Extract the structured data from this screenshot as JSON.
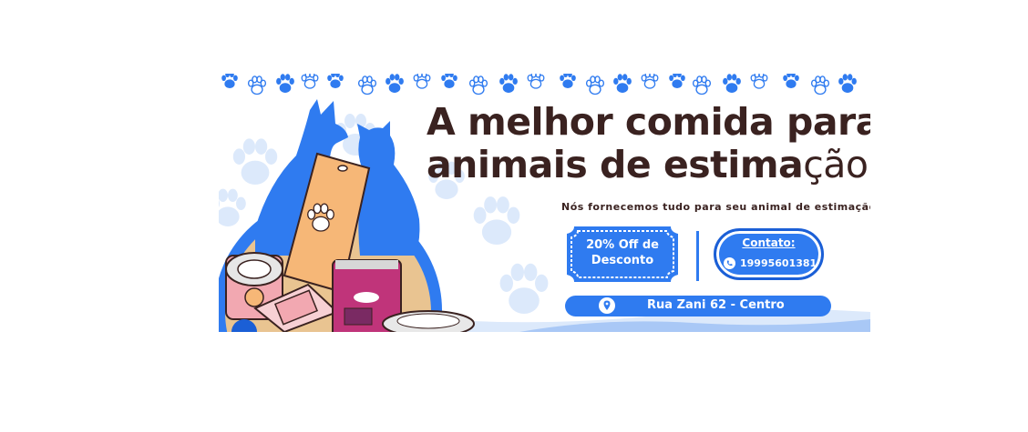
{
  "banner": {
    "headline_line1": "A melhor comida para",
    "headline_line2_bold": "animais de estima",
    "headline_line2_light": "ção",
    "subtitle": "Nós fornecemos tudo para seu animal de estimação",
    "discount_line1": "20% Off de",
    "discount_line2": "Desconto",
    "contact_label": "Contato:",
    "contact_phone": "19995601381",
    "address": "Rua Zani 62 - Centro"
  },
  "colors": {
    "brand_blue": "#2f7bf0",
    "dark_blue": "#1b5fd6",
    "light_blue": "#dce9fb",
    "headline_brown": "#3a2220",
    "bag_orange": "#f6b777",
    "bowl_tan": "#e9c491",
    "can_pink": "#f2a8b1",
    "bag_magenta": "#c0347a"
  },
  "icons": [
    "paw-print-icon",
    "phone-icon",
    "map-pin-icon",
    "dog-silhouette-icon",
    "cat-silhouette-icon"
  ]
}
